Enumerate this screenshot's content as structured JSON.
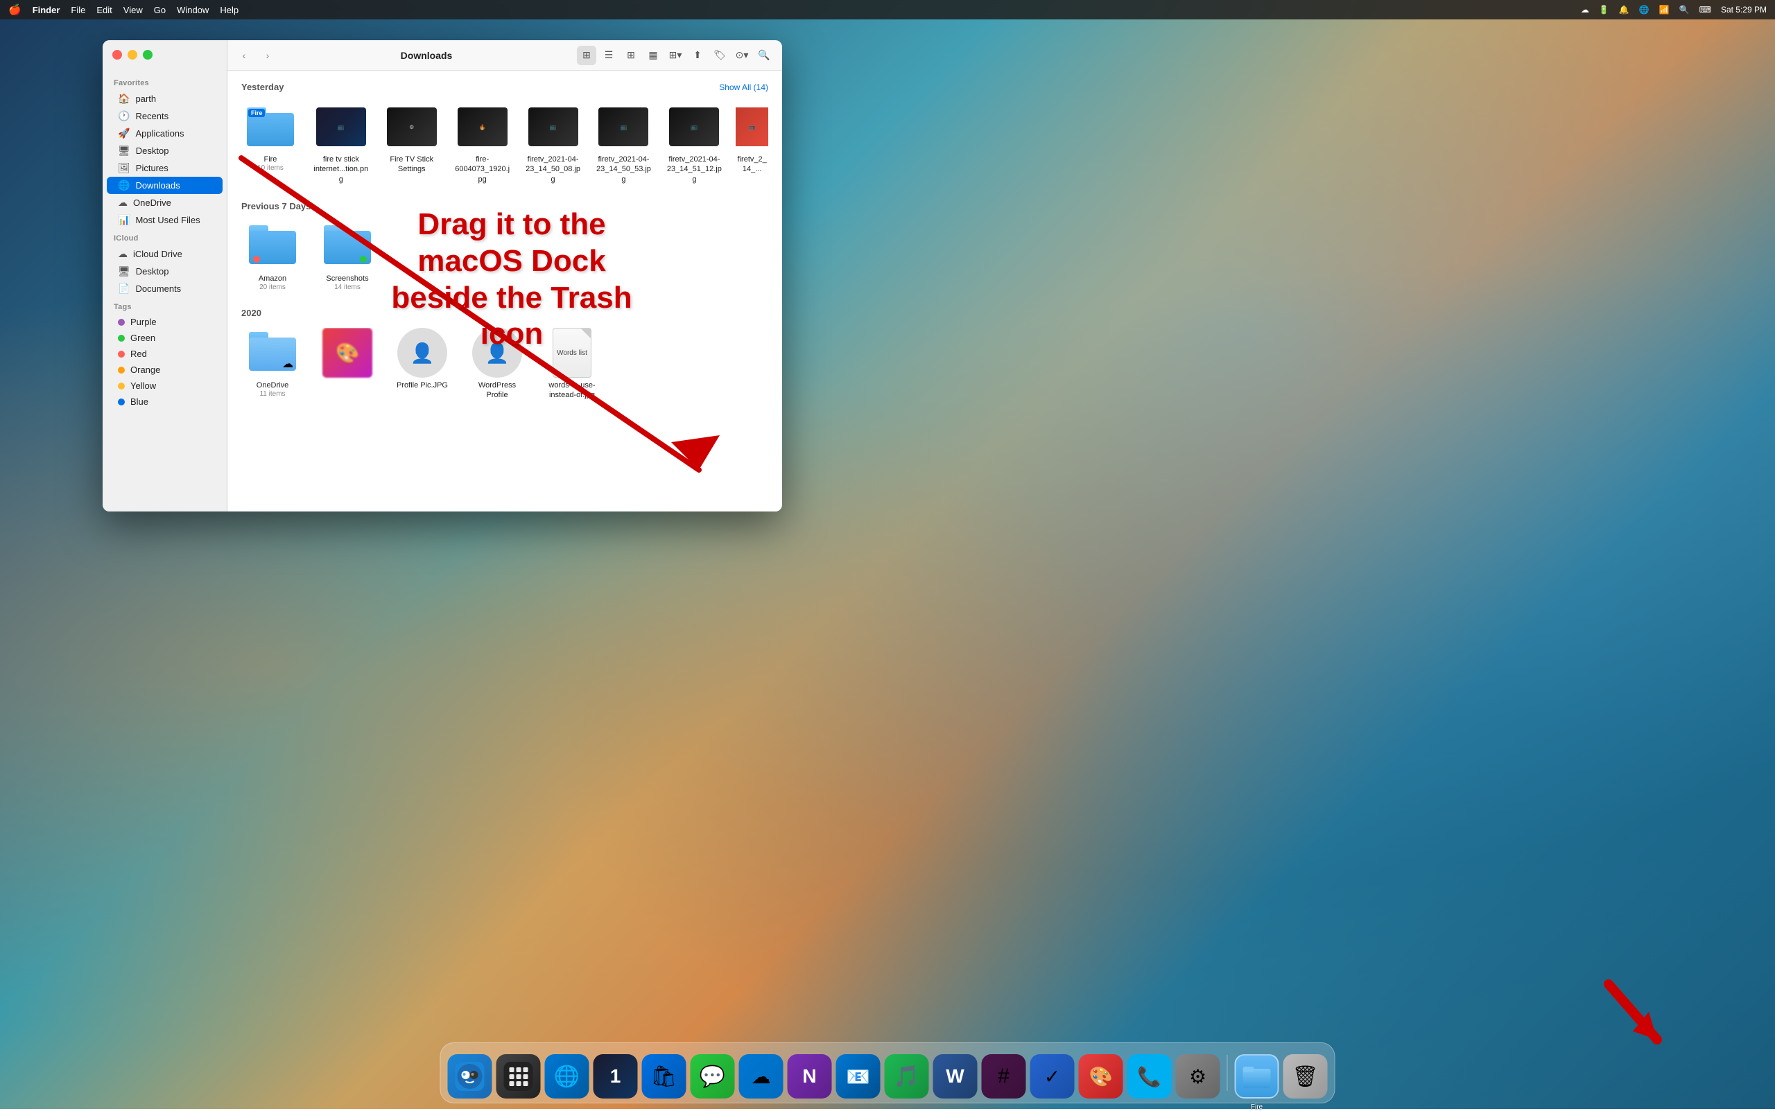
{
  "menubar": {
    "apple": "🍎",
    "appName": "Finder",
    "menus": [
      "File",
      "Edit",
      "View",
      "Go",
      "Window",
      "Help"
    ],
    "rightItems": [
      "☁",
      "🔋",
      "🔔",
      "🌐",
      "📶",
      "🔍",
      "⌨",
      "Sat 5:29 PM"
    ]
  },
  "finder": {
    "title": "Downloads",
    "backButton": "‹",
    "forwardButton": "›",
    "sections": {
      "yesterday": {
        "label": "Yesterday",
        "showAll": "Show All (14)"
      },
      "previous7days": {
        "label": "Previous 7 Days"
      },
      "year2020": {
        "label": "2020"
      }
    },
    "yesterdayFiles": [
      {
        "name": "Fire",
        "meta": "10 items",
        "type": "folder",
        "badge": "Fire"
      },
      {
        "name": "fire tv stick internet...tion.png",
        "meta": "",
        "type": "image-dark"
      },
      {
        "name": "Fire TV Stick Settings",
        "meta": "",
        "type": "image-dark"
      },
      {
        "name": "fire-6004073_1920.jpg",
        "meta": "",
        "type": "image-dark"
      },
      {
        "name": "firetv_2021-04-23_14_50_08.jpg",
        "meta": "",
        "type": "image-dark"
      },
      {
        "name": "firetv_2021-04-23_14_50_53.jpg",
        "meta": "",
        "type": "image-dark"
      },
      {
        "name": "firetv_2021-04-23_14_51_12.jpg",
        "meta": "",
        "type": "image-dark"
      },
      {
        "name": "firetv_2_14_...",
        "meta": "",
        "type": "image-red"
      }
    ],
    "previous7daysFiles": [
      {
        "name": "Amazon",
        "meta": "20 items",
        "type": "folder",
        "dotColor": "#ff5f57"
      },
      {
        "name": "Screenshots",
        "meta": "14 items",
        "type": "folder",
        "dotColor": "#28c840"
      }
    ],
    "year2020Files": [
      {
        "name": "OneDrive",
        "meta": "11 items",
        "type": "folder"
      },
      {
        "name": "",
        "meta": "",
        "type": "pixelated"
      },
      {
        "name": "Profile Pic.JPG",
        "meta": "",
        "type": "person"
      },
      {
        "name": "WordPress Profile",
        "meta": "",
        "type": "person2"
      },
      {
        "name": "words-to-use-instead-of.jpg",
        "meta": "",
        "type": "doc-image"
      }
    ]
  },
  "sidebar": {
    "favoritesLabel": "Favorites",
    "icloudLabel": "iCloud",
    "tagsLabel": "Tags",
    "favorites": [
      {
        "label": "parth",
        "icon": "🏠"
      },
      {
        "label": "Recents",
        "icon": "🕐"
      },
      {
        "label": "Applications",
        "icon": "🚀"
      },
      {
        "label": "Desktop",
        "icon": "🖥"
      },
      {
        "label": "Pictures",
        "icon": "🖼"
      },
      {
        "label": "Downloads",
        "icon": "🌐",
        "active": true
      },
      {
        "label": "OneDrive",
        "icon": "☁"
      },
      {
        "label": "Most Used Files",
        "icon": "📊"
      }
    ],
    "icloud": [
      {
        "label": "iCloud Drive",
        "icon": "☁"
      },
      {
        "label": "Desktop",
        "icon": "🖥"
      },
      {
        "label": "Documents",
        "icon": "📄"
      }
    ],
    "tags": [
      {
        "label": "Purple",
        "color": "#9b59b6"
      },
      {
        "label": "Green",
        "color": "#28c840"
      },
      {
        "label": "Red",
        "color": "#ff5f57"
      },
      {
        "label": "Orange",
        "color": "#ff9f0a"
      },
      {
        "label": "Yellow",
        "color": "#febc2e"
      },
      {
        "label": "Blue",
        "color": "#0071e3"
      }
    ]
  },
  "annotation": {
    "dragText": "Drag it to the macOS Dock beside the Trash icon"
  },
  "dock": {
    "items": [
      {
        "name": "Finder",
        "icon": "finder"
      },
      {
        "name": "Launchpad",
        "icon": "launchpad"
      },
      {
        "name": "Edge",
        "icon": "edge"
      },
      {
        "name": "1Password",
        "icon": "onepass"
      },
      {
        "name": "App Store",
        "icon": "appstore"
      },
      {
        "name": "Messages",
        "icon": "messages"
      },
      {
        "name": "OneDrive",
        "icon": "onedrive"
      },
      {
        "name": "OneNote",
        "icon": "onenote"
      },
      {
        "name": "Outlook",
        "icon": "outlook"
      },
      {
        "name": "Spotify",
        "icon": "spotify"
      },
      {
        "name": "Word",
        "icon": "word"
      },
      {
        "name": "Slack",
        "icon": "slack"
      },
      {
        "name": "Tasks",
        "icon": "tasks"
      },
      {
        "name": "Pixelmator",
        "icon": "pixelmator"
      },
      {
        "name": "Skype",
        "icon": "skype"
      },
      {
        "name": "System Preferences",
        "icon": "syspreferences"
      },
      {
        "name": "Fire",
        "icon": "fire-folder",
        "label": "Fire"
      },
      {
        "name": "Trash",
        "icon": "trash"
      }
    ]
  }
}
